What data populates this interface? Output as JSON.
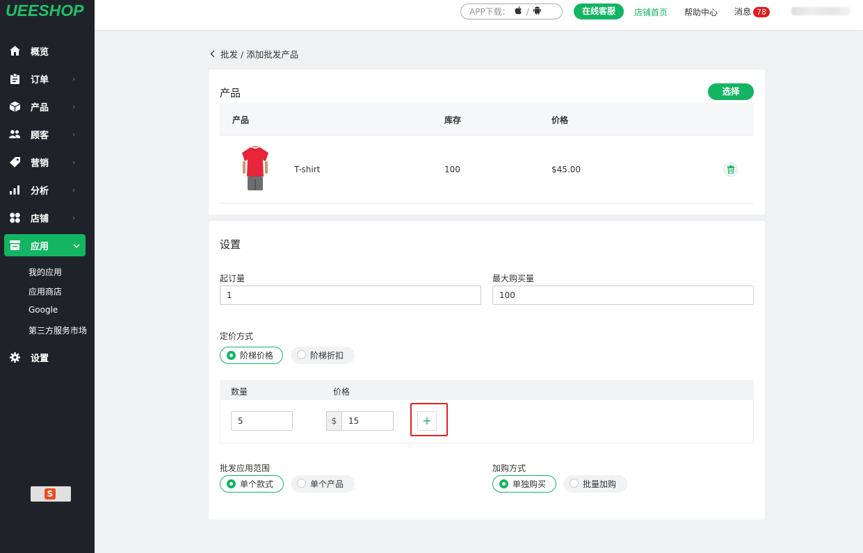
{
  "brand": {
    "logo": "UEESHOP",
    "accent": "#13b462"
  },
  "sidebar": {
    "items": [
      {
        "label": "概览",
        "icon": "home-icon"
      },
      {
        "label": "订单",
        "icon": "clipboard-icon"
      },
      {
        "label": "产品",
        "icon": "box-icon"
      },
      {
        "label": "顾客",
        "icon": "users-icon"
      },
      {
        "label": "营销",
        "icon": "tag-icon"
      },
      {
        "label": "分析",
        "icon": "bar-chart-icon"
      },
      {
        "label": "店铺",
        "icon": "grid-icon"
      },
      {
        "label": "应用",
        "icon": "store-icon"
      },
      {
        "label": "设置",
        "icon": "gear-icon"
      }
    ],
    "sub_items": [
      "我的应用",
      "应用商店",
      "Google",
      "第三方服务市场"
    ]
  },
  "header": {
    "app_download": "APP下载：",
    "separator": "/",
    "online_service": "在线客服",
    "store_home": "店铺首页",
    "help_center": "帮助中心",
    "messages": "消息",
    "message_count": "78"
  },
  "breadcrumb": {
    "parent": "批发",
    "sep": "/",
    "current": "添加批发产品"
  },
  "product_card": {
    "title": "产品",
    "select_button": "选择",
    "columns": {
      "product": "产品",
      "stock": "库存",
      "price": "价格"
    },
    "rows": [
      {
        "name": "T-shirt",
        "stock": "100",
        "price": "$45.00"
      }
    ]
  },
  "settings_card": {
    "title": "设置",
    "min_order_label": "起订量",
    "min_order_value": "1",
    "max_purchase_label": "最大购买量",
    "max_purchase_value": "100",
    "pricing_label": "定价方式",
    "pricing_options": [
      "阶梯价格",
      "阶梯折扣"
    ],
    "pricing_selected": "阶梯价格",
    "tier_columns": {
      "qty": "数量",
      "price": "价格"
    },
    "tier_qty": "5",
    "currency": "$",
    "tier_price": "15",
    "add_tier": "+",
    "scope_label": "批发应用范围",
    "scope_options": [
      "单个款式",
      "单个产品"
    ],
    "purchase_label": "加购方式",
    "purchase_options": [
      "单独购买",
      "批量加购"
    ]
  }
}
